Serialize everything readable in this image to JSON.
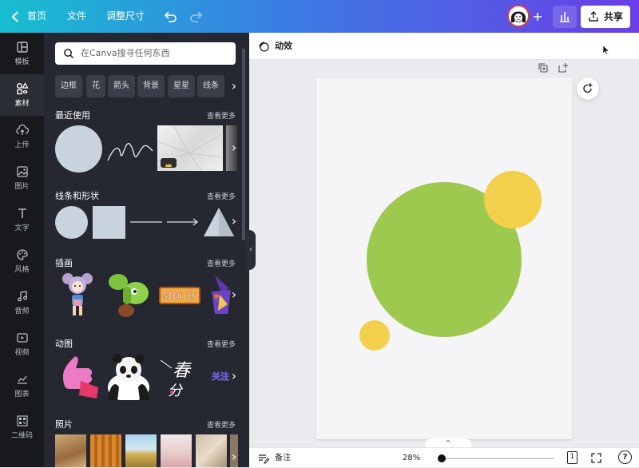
{
  "topbar": {
    "back_label": "首页",
    "file_label": "文件",
    "resize_label": "调整尺寸",
    "share_label": "共享"
  },
  "rail": [
    {
      "label": "模板",
      "icon": "layout-icon"
    },
    {
      "label": "素材",
      "icon": "elements-icon"
    },
    {
      "label": "上传",
      "icon": "upload-icon"
    },
    {
      "label": "图片",
      "icon": "image-icon"
    },
    {
      "label": "文字",
      "icon": "text-icon"
    },
    {
      "label": "风格",
      "icon": "palette-icon"
    },
    {
      "label": "音频",
      "icon": "music-icon"
    },
    {
      "label": "视频",
      "icon": "video-icon"
    },
    {
      "label": "图表",
      "icon": "chart-icon"
    },
    {
      "label": "二维码",
      "icon": "qrcode-icon"
    }
  ],
  "panel": {
    "search_placeholder": "在Canva搜寻任何东西",
    "chips": [
      "边框",
      "花",
      "箭头",
      "背景",
      "星星",
      "线条"
    ],
    "sections": [
      {
        "title": "最近使用",
        "more": "查看更多"
      },
      {
        "title": "线条和形状",
        "more": "查看更多"
      },
      {
        "title": "插画",
        "more": "查看更多"
      },
      {
        "title": "动图",
        "more": "查看更多"
      },
      {
        "title": "照片",
        "more": "查看更多"
      }
    ],
    "gif_text_1": "春",
    "gif_text_2": "分",
    "gif_text_3": "关注",
    "sign_text": "SIGN IN"
  },
  "canvas": {
    "animate_label": "动效",
    "notes_label": "备注",
    "zoom": "28%",
    "page_number": "1",
    "help": "?"
  },
  "colors": {
    "big_circle": "#9dc94f",
    "yellow_circle": "#f3d04c",
    "accent": "#7d2ae8"
  }
}
